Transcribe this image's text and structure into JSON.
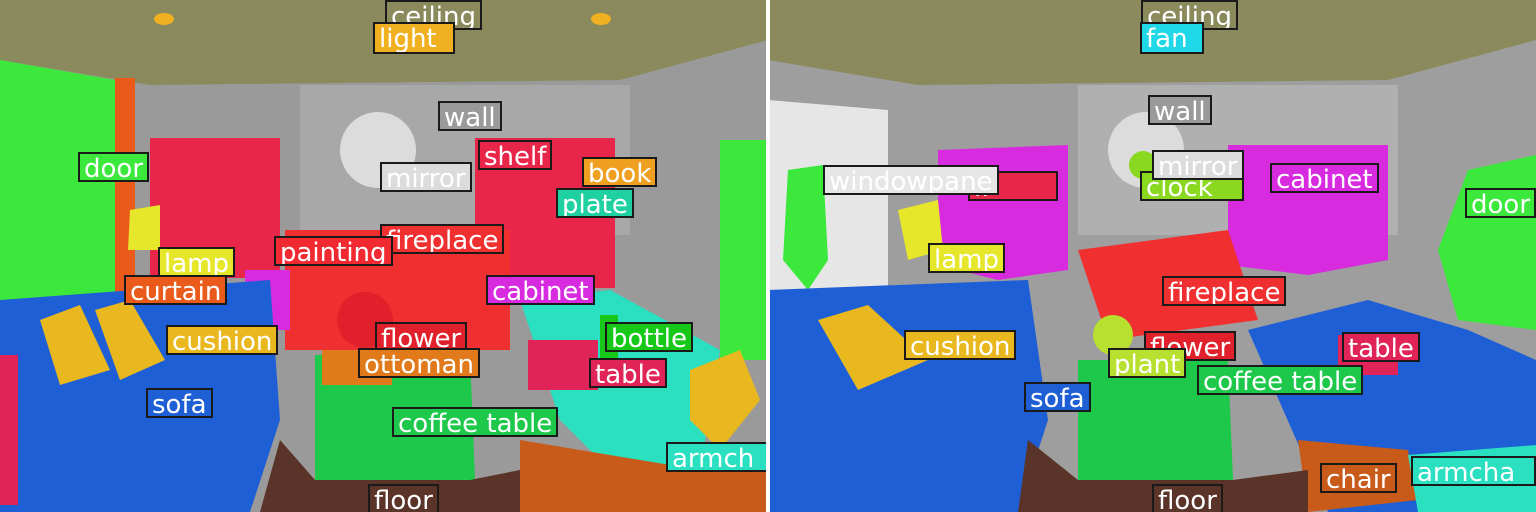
{
  "segmentation_left": {
    "ceiling": "ceiling",
    "light": "light",
    "wall": "wall",
    "door": "door",
    "shelf": "shelf",
    "book": "book",
    "mirror": "mirror",
    "plate": "plate",
    "fireplace": "fireplace",
    "painting": "painting",
    "lamp": "lamp",
    "curtain": "curtain",
    "cabinet": "cabinet",
    "cushion": "cushion",
    "flower": "flower",
    "bottle": "bottle",
    "ottoman": "ottoman",
    "table": "table",
    "sofa": "sofa",
    "coffee_table": "coffee table",
    "armchair": "armch",
    "floor": "floor"
  },
  "segmentation_right": {
    "ceiling": "ceiling",
    "fan": "fan",
    "wall": "wall",
    "windowpane": "windowpane",
    "shelf": "lf",
    "mirror": "mirror",
    "clock": "clock",
    "cabinet": "cabinet",
    "door": "door",
    "lamp": "lamp",
    "fireplace": "fireplace",
    "cushion": "cushion",
    "flower": "flower",
    "table": "table",
    "plant": "plant",
    "sofa": "sofa",
    "coffee_table": "coffee table",
    "chair": "chair",
    "armchair": "armcha",
    "floor": "floor"
  },
  "colors": {
    "ceiling": "#8a8a5c",
    "wall": "#9a9a9a",
    "sofa": "#1f5fd6",
    "cushion": "#e8b81e",
    "coffee_table": "#1ec84a",
    "fireplace": "#f03030",
    "cabinet": "#d82adf",
    "door": "#3ce83c",
    "curtain": "#ea5a1a",
    "armchair": "#2ae0c0",
    "floor": "#5a3428",
    "lamp": "#e6e62a",
    "shelf": "#e8264a",
    "book": "#f0a020",
    "plate": "#1fd0a0",
    "light": "#f0b020",
    "fan": "#20d8e8",
    "windowpane": "#e6e6e6",
    "clock": "#8ad820",
    "flower": "#e0202a",
    "plant": "#b8e030",
    "chair": "#c85a1a",
    "table": "#e02458",
    "ottoman": "#e07a1a",
    "bottle": "#18c818",
    "painting": "#f02a30"
  }
}
